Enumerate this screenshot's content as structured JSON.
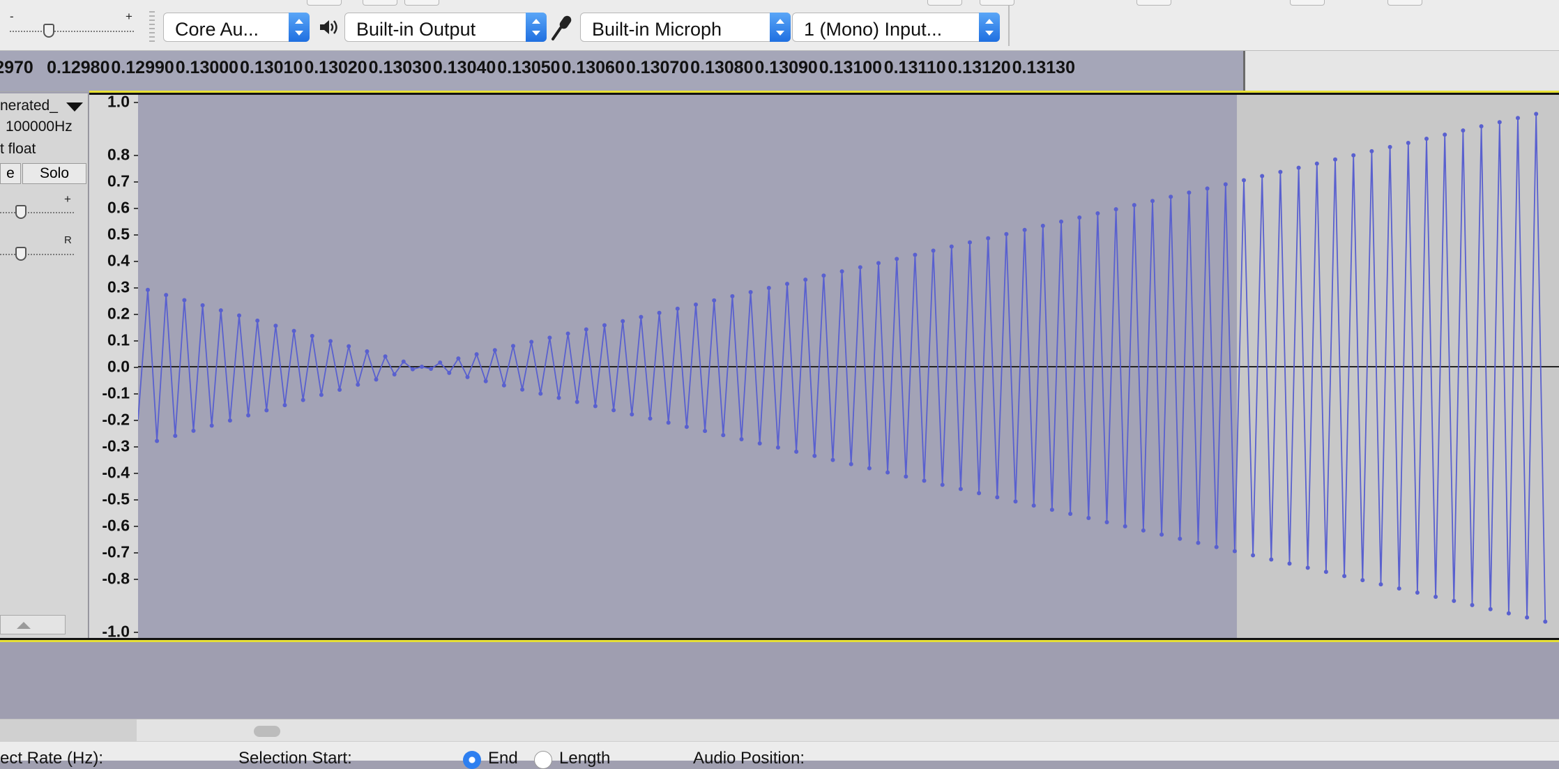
{
  "toolbar": {
    "gain_minus": "-",
    "gain_plus": "+",
    "host": "Core Au...",
    "output_device": "Built-in Output",
    "input_device": "Built-in Microph",
    "input_channels": "1 (Mono) Input..."
  },
  "ruler": {
    "labels": [
      "2970",
      "0.12980",
      "0.12990",
      "0.13000",
      "0.13010",
      "0.13020",
      "0.13030",
      "0.13040",
      "0.13050",
      "0.13060",
      "0.13070",
      "0.13080",
      "0.13090",
      "0.13100",
      "0.13110",
      "0.13120",
      "0.13130"
    ]
  },
  "track": {
    "name": "nerated_",
    "rate": "100000Hz",
    "format": "t float",
    "mute_label": "e",
    "solo_label": "Solo",
    "gain_plus": "+",
    "pan_right": "R"
  },
  "vruler": {
    "labels": [
      "1.0",
      "0.8",
      "0.7",
      "0.6",
      "0.5",
      "0.4",
      "0.3",
      "0.2",
      "0.1",
      "0.0",
      "-0.1",
      "-0.2",
      "-0.3",
      "-0.4",
      "-0.5",
      "-0.6",
      "-0.7",
      "-0.8",
      "-1.0"
    ]
  },
  "waveform": {
    "color": "#5960cf",
    "selection_color": "#a3a3b6",
    "unselected_color": "#c8c8c8",
    "samples_shown": 77,
    "amplitude_start": 0.29,
    "amplitude_zero_at_sample": 15,
    "amplitude_end": 0.97
  },
  "bottom": {
    "project_rate_label": "ect Rate (Hz):",
    "selection_start_label": "Selection Start:",
    "end_label": "End",
    "length_label": "Length",
    "audio_position_label": "Audio Position:"
  }
}
